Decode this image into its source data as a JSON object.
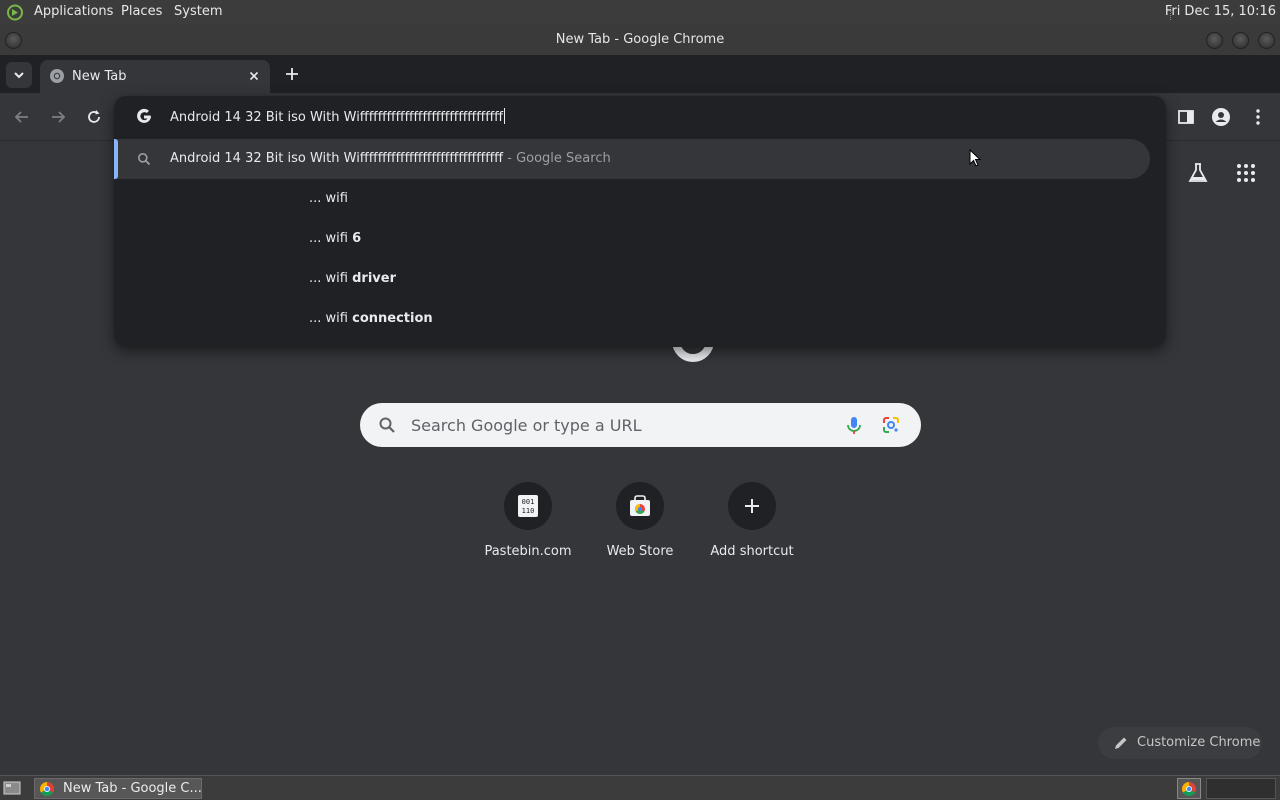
{
  "top_panel": {
    "menus": [
      "Applications",
      "Places",
      "System"
    ],
    "clock": "Fri Dec 15, 10:16"
  },
  "window": {
    "title": "New Tab - Google Chrome"
  },
  "tabs": [
    {
      "title": "New Tab",
      "active": true
    }
  ],
  "omnibox": {
    "input_value": "Android 14 32 Bit iso With Wiffffffffffffffffffffffffffffffff",
    "selected_suggestion": {
      "text": "Android 14 32 Bit iso With Wiffffffffffffffffffffffffffffffff",
      "suffix": " - Google Search"
    },
    "suggestions": [
      {
        "prefix": "... wifi",
        "bold": ""
      },
      {
        "prefix": "... wifi ",
        "bold": "6"
      },
      {
        "prefix": "... wifi ",
        "bold": "driver"
      },
      {
        "prefix": "... wifi ",
        "bold": "connection"
      }
    ]
  },
  "ntp": {
    "search_placeholder": "Search Google or type a URL",
    "shortcuts": [
      {
        "label": "Pastebin.com",
        "icon": "pastebin-icon"
      },
      {
        "label": "Web Store",
        "icon": "web-store-icon"
      },
      {
        "label": "Add shortcut",
        "icon": "plus-icon"
      }
    ],
    "customize_label": "Customize Chrome"
  },
  "taskbar": {
    "window_label": "New Tab - Google C..."
  },
  "colors": {
    "accent_blue": "#8ab4f8",
    "page_bg": "#35363a",
    "omnibox_bg": "#202124"
  }
}
